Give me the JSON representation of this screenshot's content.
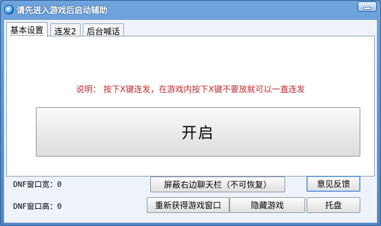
{
  "window": {
    "title": "请先进入游戏后启动辅助",
    "title_icon": "app-globe-icon",
    "minimize_icon": "minimize-icon"
  },
  "tabs": [
    {
      "label": "基本设置",
      "active": true
    },
    {
      "label": "连发2",
      "active": false
    },
    {
      "label": "后台喊话",
      "active": false
    }
  ],
  "main": {
    "instruction": "说明： 按下X键连发，在游戏内按下X键不要放就可以一直连发",
    "start_button": "开启"
  },
  "footer": {
    "width_label": "DNF窗口宽：0",
    "height_label": "DNF窗口高：0",
    "block_chat_button": "屏蔽右边聊天栏（不可恢复）",
    "feedback_button": "意见反馈",
    "reacquire_button": "重新获得游戏窗口",
    "hide_game_button": "隐藏游戏",
    "tray_button": "托盘"
  },
  "colors": {
    "titlebar": "#5b8ec9",
    "instruction_text": "#c0282d",
    "client_bg": "#eef3fa"
  }
}
